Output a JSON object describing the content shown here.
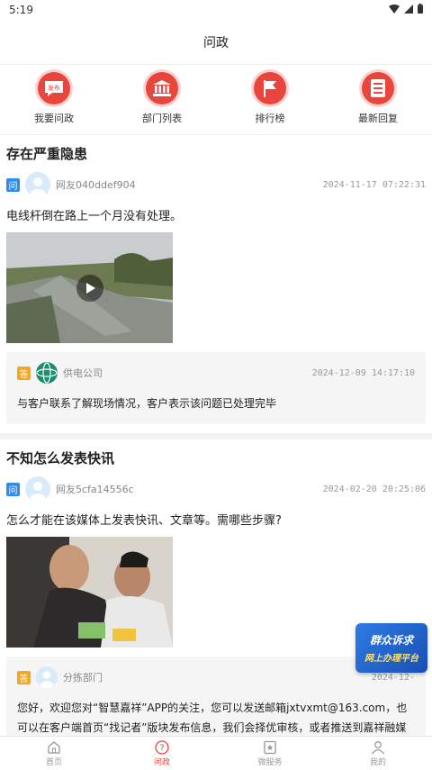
{
  "status_bar": {
    "time": "5:19"
  },
  "header": {
    "title": "问政"
  },
  "quick_nav": [
    {
      "label": "我要问政",
      "icon": "publish-icon",
      "badge": "发布"
    },
    {
      "label": "部门列表",
      "icon": "building-icon"
    },
    {
      "label": "排行榜",
      "icon": "flag-icon"
    },
    {
      "label": "最新回复",
      "icon": "document-icon"
    }
  ],
  "posts": [
    {
      "title": "存在严重隐患",
      "tag": "问",
      "user": "网友040ddef904",
      "date": "2024-11-17 07:22:31",
      "content": "电线杆倒在路上一个月没有处理。",
      "reply": {
        "tag": "答",
        "name": "供电公司",
        "date": "2024-12-09 14:17:10",
        "content": "与客户联系了解现场情况，客户表示该问题已处理完毕"
      }
    },
    {
      "title": "不知怎么发表快讯",
      "tag": "问",
      "user": "网友5cfa14556c",
      "date": "2024-02-20 20:25:06",
      "content": "怎么才能在该媒体上发表快讯、文章等。需哪些步骤?",
      "reply": {
        "tag": "答",
        "name": "分拣部门",
        "date": "2024-12-",
        "content": "您好，欢迎您对“智慧嘉祥”APP的关注，您可以发送邮箱jxtvxmt@163.com，也可以在客户端首页“找记者”版块发布信息，我们会择优审核，或者推送到嘉祥融媒其他媒体账号，感谢您的关注，期待您的投稿!"
      }
    }
  ],
  "float_banner": {
    "line1": "群众诉求",
    "line2": "网上办理平台"
  },
  "bottom_nav": [
    {
      "label": "首页",
      "icon": "home-icon"
    },
    {
      "label": "问政",
      "icon": "question-icon",
      "active": true
    },
    {
      "label": "微服务",
      "icon": "service-icon"
    },
    {
      "label": "我的",
      "icon": "user-icon"
    }
  ],
  "colors": {
    "accent": "#e8453c",
    "question_tag": "#2f8cf0",
    "answer_tag": "#f5a623"
  }
}
